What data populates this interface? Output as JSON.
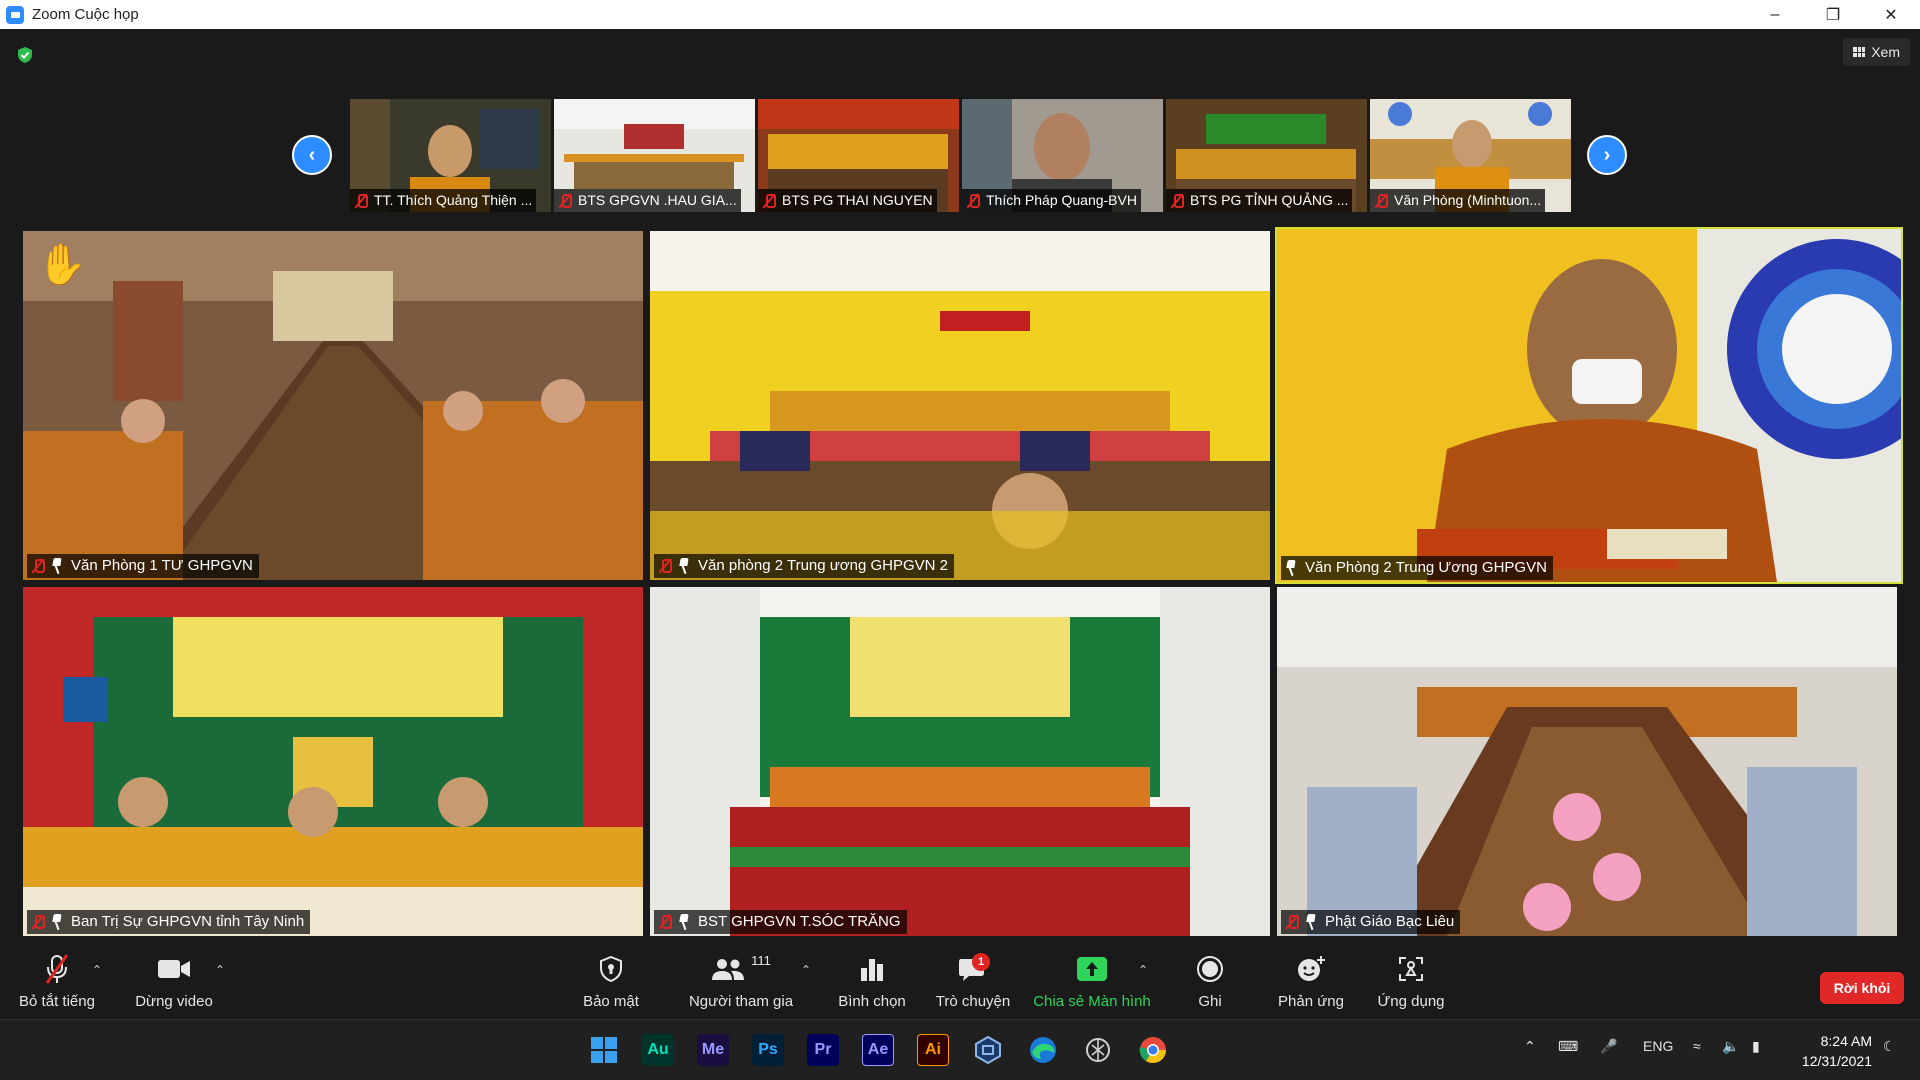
{
  "window": {
    "title": "Zoom Cuộc họp"
  },
  "top": {
    "view_label": "Xem"
  },
  "thumbnails": [
    {
      "name": "TT. Thích Quảng Thiện ..."
    },
    {
      "name": "BTS GPGVN .HAU GIA..."
    },
    {
      "name": "BTS PG THAI NGUYEN"
    },
    {
      "name": "Thích Pháp Quang-BVH"
    },
    {
      "name": "BTS PG TỈNH QUẢNG ..."
    },
    {
      "name": "Văn Phòng (Minhtuon..."
    }
  ],
  "tiles": [
    {
      "name": "Văn Phòng 1 TƯ GHPGVN"
    },
    {
      "name": "Văn phòng 2 Trung ương GHPGVN 2"
    },
    {
      "name": "Văn Phòng 2 Trung Ương GHPGVN"
    },
    {
      "name": "Ban Trị Sự GHPGVN tỉnh Tây Ninh"
    },
    {
      "name": "BST GHPGVN T.SÓC TRĂNG"
    },
    {
      "name": "Phật Giáo Bạc Liêu"
    }
  ],
  "toolbar": {
    "mute": "Bỏ tắt tiếng",
    "video": "Dừng video",
    "security": "Bảo mật",
    "participants": "Người tham gia",
    "participants_count": "111",
    "polls": "Bình chọn",
    "chat": "Trò chuyện",
    "chat_badge": "1",
    "share": "Chia sẻ Màn hình",
    "record": "Ghi",
    "reactions": "Phản ứng",
    "apps": "Ứng dụng",
    "leave": "Rời khỏi"
  },
  "taskbar": {
    "apps": [
      {
        "label": "",
        "icon": "windows-start-icon",
        "color": "#3aa0f0"
      },
      {
        "label": "Au",
        "icon": "audition-icon",
        "color": "#00e4bb"
      },
      {
        "label": "Me",
        "icon": "media-encoder-icon",
        "color": "#9999ff"
      },
      {
        "label": "Ps",
        "icon": "photoshop-icon",
        "color": "#31a8ff"
      },
      {
        "label": "Pr",
        "icon": "premiere-icon",
        "color": "#9999ff"
      },
      {
        "label": "Ae",
        "icon": "after-effects-icon",
        "color": "#9999ff"
      },
      {
        "label": "Ai",
        "icon": "illustrator-icon",
        "color": "#ff9a00"
      },
      {
        "label": "",
        "icon": "app-icon",
        "color": "#8fb8e8"
      },
      {
        "label": "",
        "icon": "edge-icon",
        "color": "#2bb673"
      },
      {
        "label": "",
        "icon": "openai-icon",
        "color": "#d0d0d0"
      },
      {
        "label": "",
        "icon": "chrome-icon",
        "color": "#e84b3c"
      }
    ],
    "lang": "ENG",
    "time": "8:24 AM",
    "date": "12/31/2021"
  }
}
